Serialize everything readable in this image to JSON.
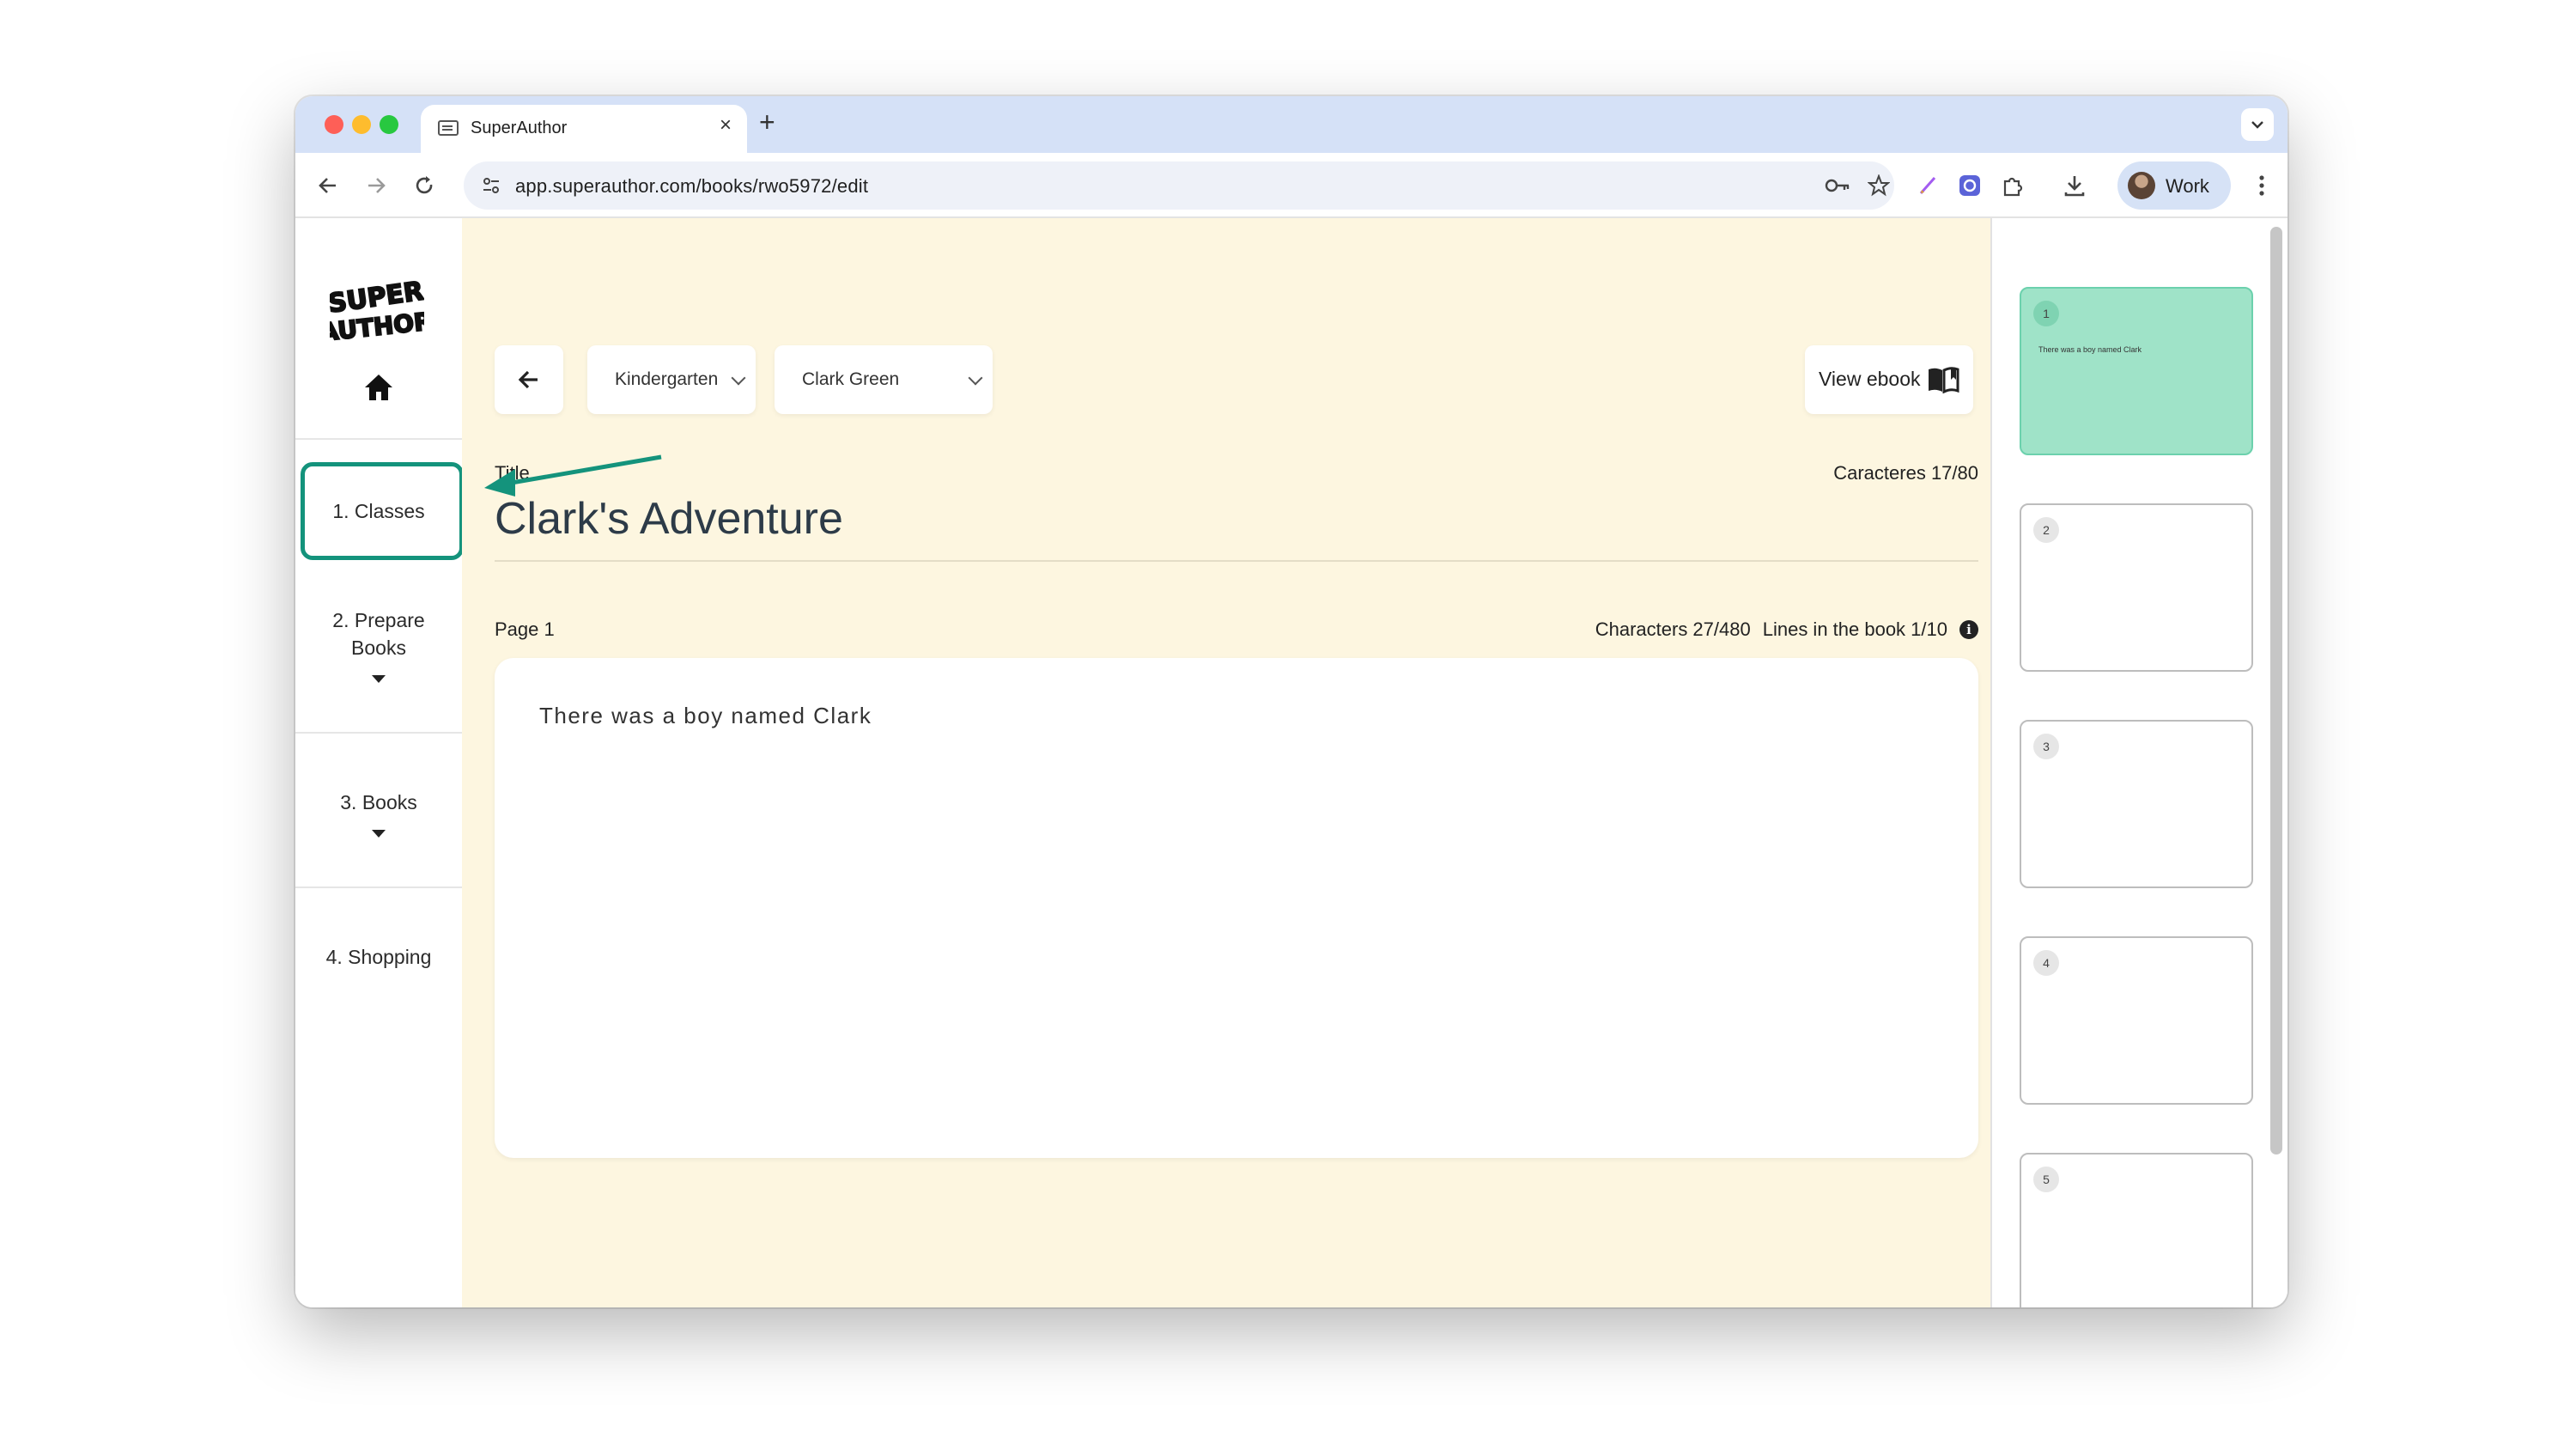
{
  "browser": {
    "tab_title": "SuperAuthor",
    "url": "app.superauthor.com/books/rwo5972/edit",
    "profile_label": "Work"
  },
  "sidebar": {
    "logo_text": "SUPER AUTHOR",
    "items": [
      {
        "label": "1. Classes"
      },
      {
        "label": "2. Prepare Books"
      },
      {
        "label": "3. Books"
      },
      {
        "label": "4. Shopping"
      }
    ]
  },
  "editor": {
    "grade_select": "Kindergarten",
    "student_select": "Clark Green",
    "view_ebook_label": "View ebook",
    "title_label": "Title",
    "title_count": "Caracteres 17/80",
    "title_value": "Clark's Adventure",
    "page_label": "Page 1",
    "characters_count": "Characters 27/480",
    "lines_count": "Lines in the book 1/10",
    "page_text": "There was a boy named Clark"
  },
  "pages": [
    {
      "number": "1",
      "text": "There was a boy named Clark",
      "active": true
    },
    {
      "number": "2",
      "text": ""
    },
    {
      "number": "3",
      "text": ""
    },
    {
      "number": "4",
      "text": ""
    },
    {
      "number": "5",
      "text": ""
    }
  ],
  "colors": {
    "accent": "#14937c",
    "editor_background": "#fdf6e0",
    "active_thumbnail": "#9fe3c8",
    "tab_strip": "#d5e1f7"
  },
  "icons": [
    "back-arrow-icon",
    "forward-arrow-icon",
    "reload-icon",
    "site-info-icon",
    "password-key-icon",
    "bookmark-star-icon",
    "pen-extension-icon",
    "extension-icon",
    "puzzle-icon",
    "download-icon",
    "more-vert-icon",
    "home-icon",
    "chevron-down-icon",
    "book-icon",
    "info-icon"
  ]
}
